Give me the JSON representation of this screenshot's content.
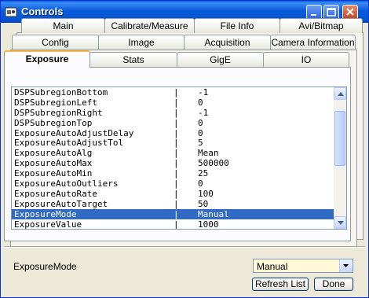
{
  "window": {
    "title": "Controls"
  },
  "tabs": {
    "row1": [
      "Main",
      "Calibrate/Measure",
      "File Info",
      "Avi/Bitmap"
    ],
    "row2": [
      "Config",
      "Image",
      "Acquisition",
      "Camera Information"
    ],
    "row3": [
      "Exposure",
      "Stats",
      "GigE",
      "IO"
    ],
    "active": "Exposure"
  },
  "properties": [
    {
      "name": "DSPSubregionBottom",
      "sep": "|",
      "value": "-1"
    },
    {
      "name": "DSPSubregionLeft",
      "sep": "|",
      "value": "0"
    },
    {
      "name": "DSPSubregionRight",
      "sep": "|",
      "value": "-1"
    },
    {
      "name": "DSPSubregionTop",
      "sep": "|",
      "value": "0"
    },
    {
      "name": "ExposureAutoAdjustDelay",
      "sep": "|",
      "value": "0"
    },
    {
      "name": "ExposureAutoAdjustTol",
      "sep": "|",
      "value": "5"
    },
    {
      "name": "ExposureAutoAlg",
      "sep": "|",
      "value": "Mean"
    },
    {
      "name": "ExposureAutoMax",
      "sep": "|",
      "value": "500000"
    },
    {
      "name": "ExposureAutoMin",
      "sep": "|",
      "value": "25"
    },
    {
      "name": "ExposureAutoOutliers",
      "sep": "|",
      "value": "0"
    },
    {
      "name": "ExposureAutoRate",
      "sep": "|",
      "value": "100"
    },
    {
      "name": "ExposureAutoTarget",
      "sep": "|",
      "value": "50"
    },
    {
      "name": "ExposureMode",
      "sep": "|",
      "value": "Manual"
    },
    {
      "name": "ExposureValue",
      "sep": "|",
      "value": "1000"
    }
  ],
  "selected_property": "ExposureMode",
  "footer": {
    "label": "ExposureMode",
    "select_value": "Manual",
    "refresh_label": "Refresh List",
    "done_label": "Done"
  },
  "colors": {
    "selection": "#316ac5",
    "title_bar": "#0a5cda",
    "select_bg": "#fff8d8"
  }
}
